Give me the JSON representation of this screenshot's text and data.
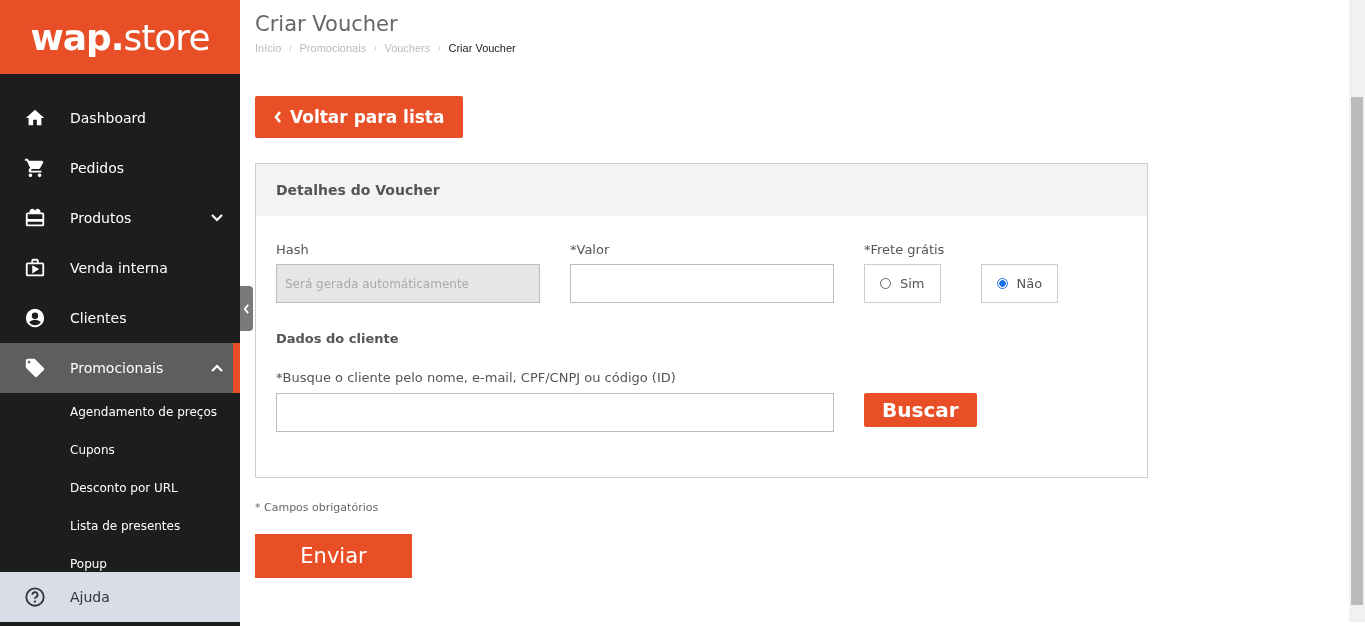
{
  "brand": {
    "bold": "wap.",
    "light": "store"
  },
  "sidebar": {
    "items": [
      {
        "label": "Dashboard",
        "selected": false
      },
      {
        "label": "Pedidos",
        "selected": false
      },
      {
        "label": "Produtos",
        "selected": false,
        "expanded": false
      },
      {
        "label": "Venda interna",
        "selected": false
      },
      {
        "label": "Clientes",
        "selected": false
      },
      {
        "label": "Promocionais",
        "selected": true,
        "expanded": true,
        "children": [
          {
            "label": "Agendamento de preços"
          },
          {
            "label": "Cupons"
          },
          {
            "label": "Desconto por URL"
          },
          {
            "label": "Lista de presentes"
          },
          {
            "label": "Popup"
          }
        ]
      }
    ],
    "help": "Ajuda"
  },
  "page": {
    "title": "Criar Voucher",
    "breadcrumb": [
      "Início",
      "Promocionais",
      "Vouchers",
      "Criar Voucher"
    ],
    "breadcrumb_separator": "/",
    "back_button": "Voltar para lista",
    "panel": {
      "title": "Detalhes do Voucher",
      "hash": {
        "label": "Hash",
        "placeholder": "Será gerada automáticamente"
      },
      "value": {
        "label": "*Valor"
      },
      "free_shipping": {
        "label": "*Frete grátis",
        "options": [
          {
            "label": "Sim",
            "selected": false
          },
          {
            "label": "Não",
            "selected": true
          }
        ]
      },
      "client_section": "Dados do cliente",
      "search": {
        "label": "*Busque o cliente pelo nome, e-mail, CPF/CNPJ ou código (ID)",
        "button": "Buscar"
      }
    },
    "required_note": "* Campos obrigatórios",
    "submit": "Enviar"
  }
}
